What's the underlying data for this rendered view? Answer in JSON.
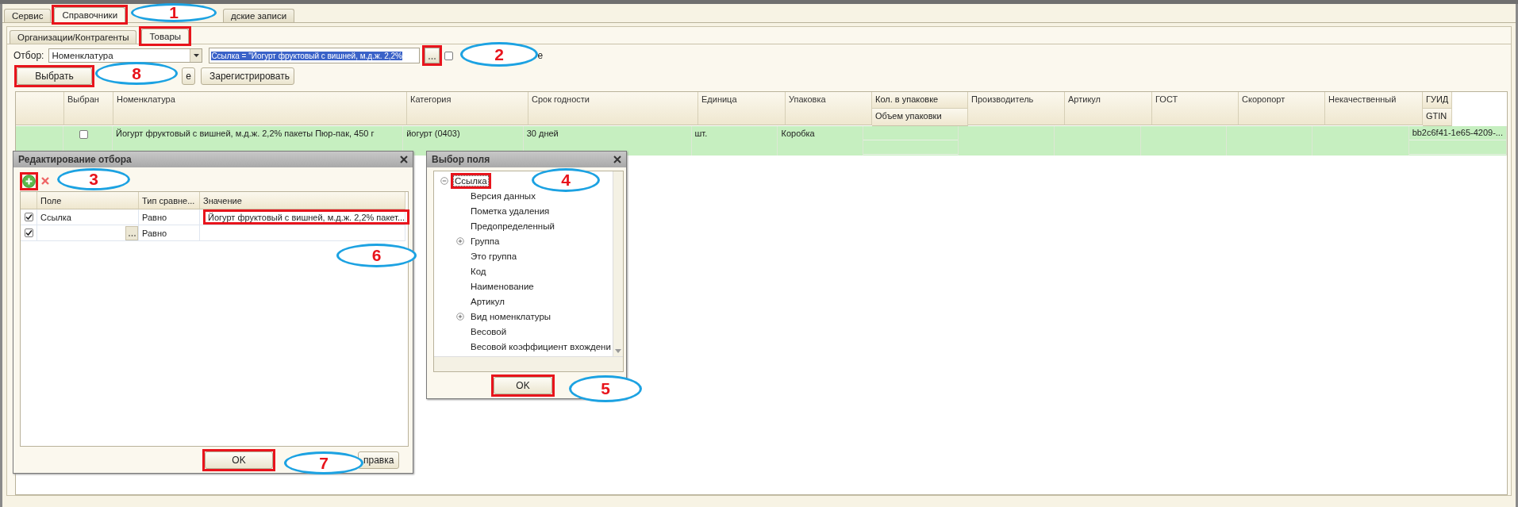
{
  "tabs": [
    {
      "label": "Сервис",
      "selected": false,
      "highlighted": false
    },
    {
      "label": "Справочники",
      "selected": true,
      "highlighted": true
    },
    {
      "label": "дские записи",
      "selected": false,
      "highlighted": false
    }
  ],
  "subtabs": [
    {
      "label": "Организации/Контрагенты",
      "selected": false,
      "highlighted": false
    },
    {
      "label": "Товары",
      "selected": true,
      "highlighted": true
    }
  ],
  "filter": {
    "label": "Отбор:",
    "field": "Номенклатура",
    "condition": "Ссылка = \"Йогурт фруктовый с вишней, м.д.ж. 2,2%",
    "browse_button": {
      "highlighted": true
    },
    "checkbox": {
      "checked": false,
      "label": "е"
    }
  },
  "buttons": [
    {
      "label": "Выбрать",
      "highlighted": true
    },
    {
      "label": "е",
      "highlighted": false
    },
    {
      "label": "Зарегистрировать",
      "highlighted": false
    }
  ],
  "table": {
    "columns": [
      {
        "kind": "check",
        "label": "Выбран"
      },
      {
        "kind": "text",
        "label": "Номенклатура"
      },
      {
        "kind": "text",
        "label": "Категория"
      },
      {
        "kind": "text",
        "label": "Срок годности"
      },
      {
        "kind": "text",
        "label": "Единица"
      },
      {
        "kind": "text",
        "label": "Упаковка"
      },
      {
        "kind": "double",
        "label": "Кол. в упаковке",
        "sublabel": "Объем упаковки"
      },
      {
        "kind": "text",
        "label": "Производитель"
      },
      {
        "kind": "text",
        "label": "Артикул"
      },
      {
        "kind": "text",
        "label": "ГОСТ"
      },
      {
        "kind": "text",
        "label": "Скоропорт"
      },
      {
        "kind": "text",
        "label": "Некачественный"
      },
      {
        "kind": "double",
        "label": "ГУИД",
        "sublabel": "GTIN"
      }
    ],
    "rows": [
      {
        "selected": true,
        "checked": false,
        "cells": [
          null,
          "Йогурт фруктовый с вишней, м.д.ж. 2,2% пакеты Пюр-пак, 450 г",
          "йогурт (0403)",
          "30 дней",
          "шт.",
          "Коробка",
          null,
          null,
          null,
          null,
          null,
          null,
          "bb2c6f41-1e65-4209-..."
        ]
      }
    ]
  },
  "filter_dialog": {
    "title": "Редактирование отбора",
    "toolbar": [
      {
        "kind": "add",
        "highlighted": true
      },
      {
        "kind": "delete",
        "highlighted": false
      }
    ],
    "columns": [
      "Поле",
      "Тип сравне...",
      "Значение"
    ],
    "rows": [
      {
        "checked": true,
        "field": "Ссылка",
        "comparison": "Равно",
        "value": "Йогурт фруктовый с вишней, м.д.ж. 2,2% пакет...",
        "highlighted": true
      },
      {
        "checked": true,
        "comparison": "Равно",
        "highlighted": false
      }
    ],
    "buttons": [
      {
        "label": "OK",
        "highlighted": true
      },
      {
        "label": "правка",
        "highlighted": false
      }
    ]
  },
  "field_dialog": {
    "title": "Выбор поля",
    "tree": {
      "label": "Ссылка",
      "expanded": true,
      "selected": true,
      "highlighted": true,
      "children": [
        {
          "label": "Версия данных",
          "selected": false
        },
        {
          "label": "Пометка удаления",
          "selected": false
        },
        {
          "label": "Предопределенный",
          "selected": false
        },
        {
          "label": "Группа",
          "expanded": false,
          "selected": false
        },
        {
          "label": "Это группа",
          "selected": false
        },
        {
          "label": "Код",
          "selected": false
        },
        {
          "label": "Наименование",
          "selected": false
        },
        {
          "label": "Артикул",
          "selected": false
        },
        {
          "label": "Вид номенклатуры",
          "expanded": false,
          "selected": false
        },
        {
          "label": "Весовой",
          "selected": false
        },
        {
          "label": "Весовой коэффициент вхождени",
          "selected": false
        }
      ]
    },
    "buttons": [
      {
        "label": "OK",
        "highlighted": true
      }
    ]
  },
  "annotations": [
    "1",
    "2",
    "3",
    "4",
    "5",
    "6",
    "7",
    "8"
  ]
}
